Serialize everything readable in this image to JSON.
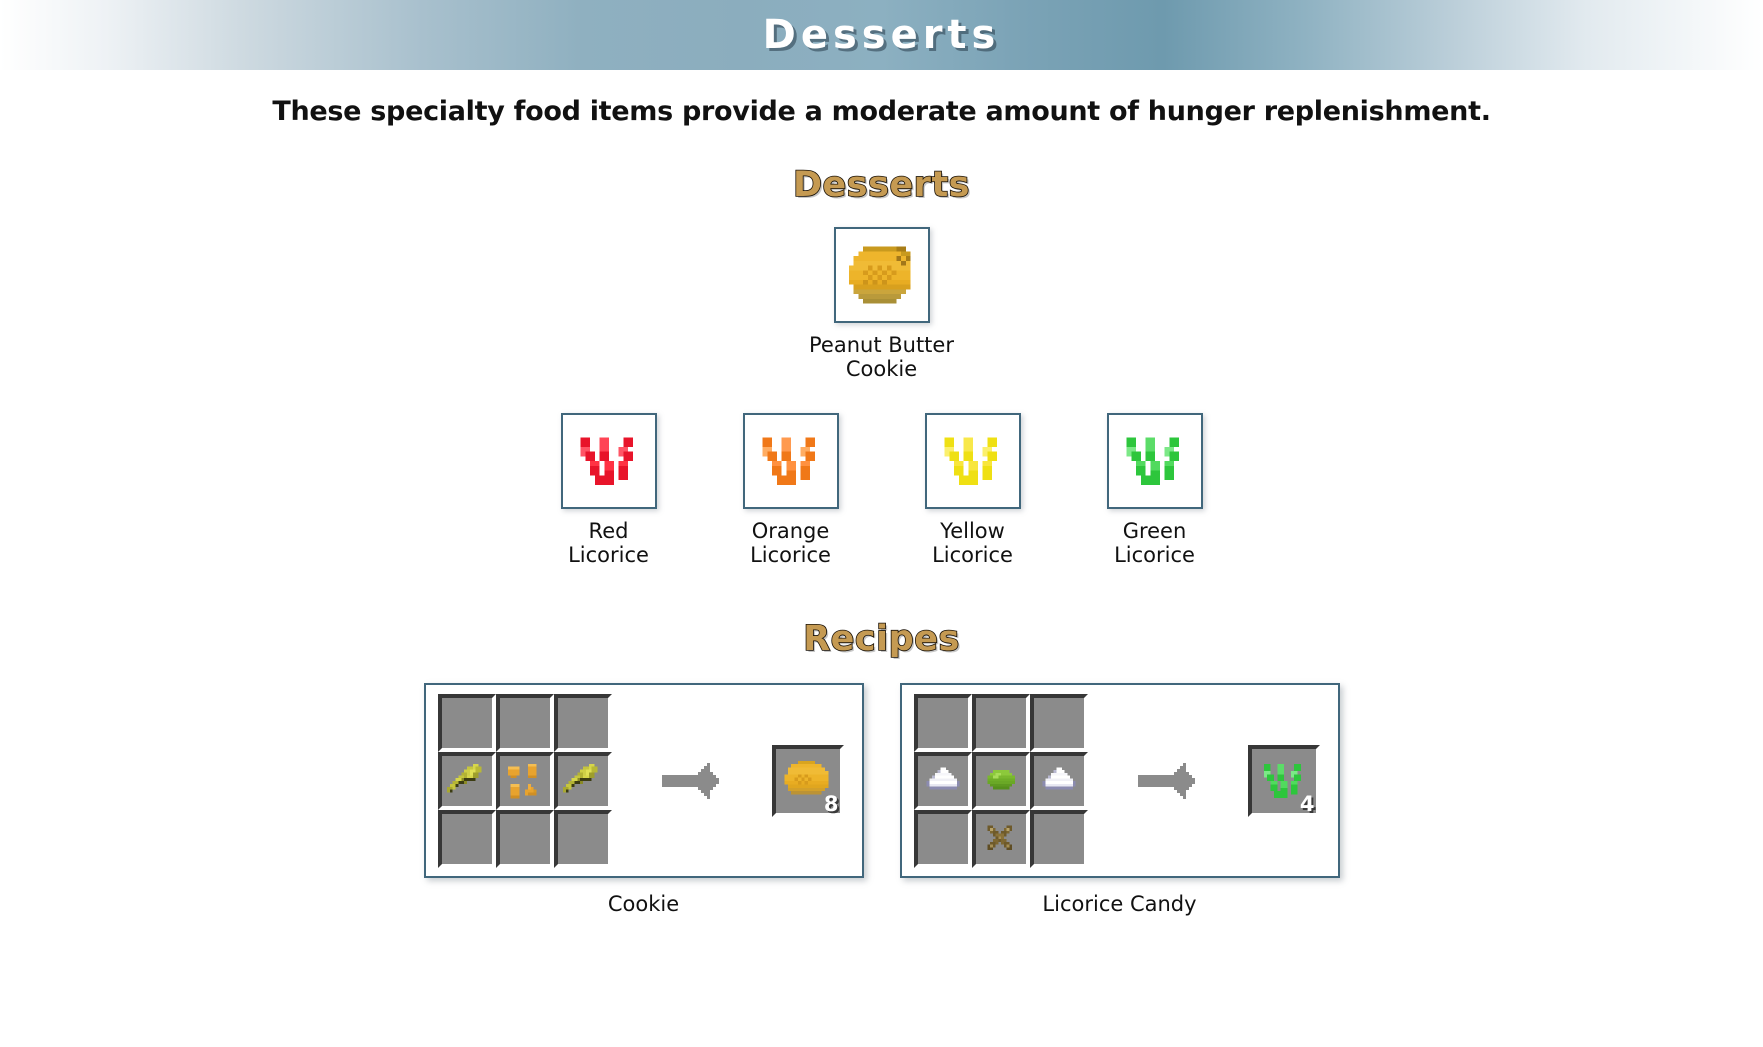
{
  "banner": {
    "title": "Desserts"
  },
  "intro": {
    "text": "These specialty food items provide a moderate amount of hunger replenishment."
  },
  "sections": {
    "desserts_heading": "Desserts",
    "recipes_heading": "Recipes"
  },
  "items": {
    "row1": [
      {
        "name": "Peanut Butter\nCookie",
        "icon": "peanut-butter-cookie-icon",
        "color": "#e8a317"
      }
    ],
    "row2": [
      {
        "name": "Red\nLicorice",
        "icon": "red-licorice-icon",
        "color": "#e8142a"
      },
      {
        "name": "Orange\nLicorice",
        "icon": "orange-licorice-icon",
        "color": "#f07818"
      },
      {
        "name": "Yellow\nLicorice",
        "icon": "yellow-licorice-icon",
        "color": "#efe013"
      },
      {
        "name": "Green\nLicorice",
        "icon": "green-licorice-icon",
        "color": "#2dc63c"
      }
    ]
  },
  "recipes": [
    {
      "label": "Cookie",
      "output": {
        "icon": "cookie-icon",
        "count": "8"
      },
      "grid": [
        [
          "",
          "",
          ""
        ],
        [
          "wheat-icon",
          "peanut-icon",
          "wheat-icon"
        ],
        [
          "",
          "",
          ""
        ]
      ]
    },
    {
      "label": "Licorice Candy",
      "output": {
        "icon": "green-licorice-icon",
        "count": "4"
      },
      "grid": [
        [
          "",
          "",
          ""
        ],
        [
          "sugar-icon",
          "green-dye-icon",
          "sugar-icon"
        ],
        [
          "",
          "stick-cross-icon",
          ""
        ]
      ]
    }
  ],
  "colors": {
    "heading_gold": "#c59a52",
    "box_border": "#41677c",
    "slot_bg": "#8b8b8b",
    "slot_dark": "#373737",
    "arrow": "#8b8b8b",
    "banner_mid": "#7ba3b6"
  }
}
